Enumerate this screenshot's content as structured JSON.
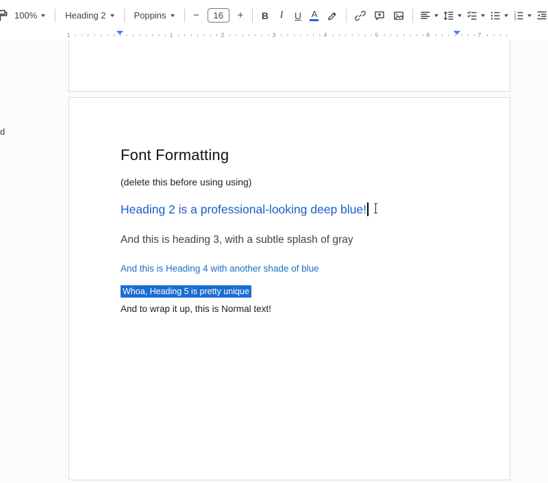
{
  "toolbar": {
    "zoom_value": "100%",
    "style_value": "Heading 2",
    "font_value": "Poppins",
    "font_size_value": "16",
    "decrease_label": "−",
    "increase_label": "+",
    "bold_label": "B",
    "italic_label": "I",
    "underline_label": "U",
    "text_color_label": "A",
    "icon_names": [
      "paint-format",
      "highlight-color",
      "insert-link",
      "add-comment",
      "insert-image",
      "text-align",
      "line-spacing",
      "checklist",
      "bulleted-list",
      "numbered-list",
      "decrease-indent",
      "increase-indent",
      "clear-formatting"
    ]
  },
  "ruler": {
    "margin_number": "1",
    "numbers": [
      "1",
      "2",
      "3",
      "4",
      "5",
      "6",
      "7"
    ]
  },
  "edge": {
    "clipped_text": "d"
  },
  "doc": {
    "title": "Font Formatting",
    "note": "(delete this before using using)",
    "h2": "Heading 2 is a professional-looking deep blue!",
    "h3": "And this is heading 3, with a subtle splash of gray",
    "h4": "And this is Heading 4 with another shade of blue",
    "h5": "Whoa, Heading 5 is pretty unique",
    "normal": "And to wrap it up, this is Normal text!"
  },
  "colors": {
    "h2_blue": "#1a5fc9",
    "h3_gray": "#3e4347",
    "h4_blue": "#1a6ec9",
    "selection_bg": "#1a6dd2",
    "marker_blue": "#4285f4",
    "text_color_bar": "#1967d2",
    "toolbar_icon": "#444746"
  }
}
